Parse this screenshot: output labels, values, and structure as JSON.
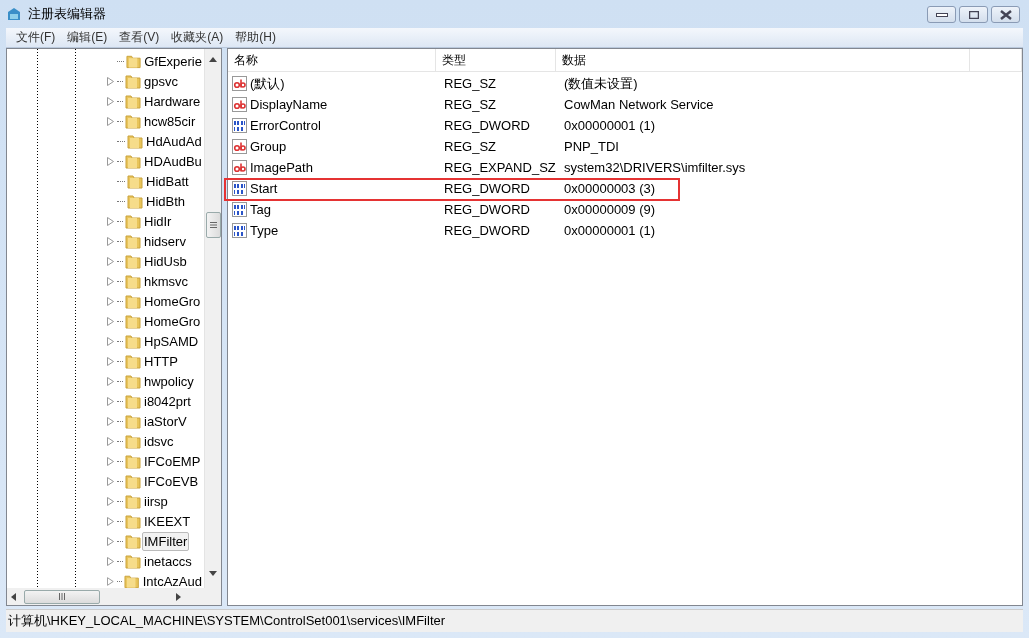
{
  "window": {
    "title": "注册表编辑器"
  },
  "menu": [
    "文件(F)",
    "编辑(E)",
    "查看(V)",
    "收藏夹(A)",
    "帮助(H)"
  ],
  "tree": [
    {
      "label": "GfExperie",
      "expandable": false,
      "selected": false
    },
    {
      "label": "gpsvc",
      "expandable": true,
      "selected": false
    },
    {
      "label": "Hardware",
      "expandable": true,
      "selected": false
    },
    {
      "label": "hcw85cir",
      "expandable": true,
      "selected": false
    },
    {
      "label": "HdAudAd",
      "expandable": false,
      "selected": false
    },
    {
      "label": "HDAudBu",
      "expandable": true,
      "selected": false
    },
    {
      "label": "HidBatt",
      "expandable": false,
      "selected": false
    },
    {
      "label": "HidBth",
      "expandable": false,
      "selected": false
    },
    {
      "label": "HidIr",
      "expandable": true,
      "selected": false
    },
    {
      "label": "hidserv",
      "expandable": true,
      "selected": false
    },
    {
      "label": "HidUsb",
      "expandable": true,
      "selected": false
    },
    {
      "label": "hkmsvc",
      "expandable": true,
      "selected": false
    },
    {
      "label": "HomeGro",
      "expandable": true,
      "selected": false
    },
    {
      "label": "HomeGro",
      "expandable": true,
      "selected": false
    },
    {
      "label": "HpSAMD",
      "expandable": true,
      "selected": false
    },
    {
      "label": "HTTP",
      "expandable": true,
      "selected": false
    },
    {
      "label": "hwpolicy",
      "expandable": true,
      "selected": false
    },
    {
      "label": "i8042prt",
      "expandable": true,
      "selected": false
    },
    {
      "label": "iaStorV",
      "expandable": true,
      "selected": false
    },
    {
      "label": "idsvc",
      "expandable": true,
      "selected": false
    },
    {
      "label": "IFCoEMP",
      "expandable": true,
      "selected": false
    },
    {
      "label": "IFCoEVB",
      "expandable": true,
      "selected": false
    },
    {
      "label": "iirsp",
      "expandable": true,
      "selected": false
    },
    {
      "label": "IKEEXT",
      "expandable": true,
      "selected": false
    },
    {
      "label": "IMFilter",
      "expandable": true,
      "selected": true
    },
    {
      "label": "inetaccs",
      "expandable": true,
      "selected": false
    },
    {
      "label": "IntcAzAud",
      "expandable": true,
      "selected": false
    }
  ],
  "table": {
    "columns": [
      "名称",
      "类型",
      "数据"
    ],
    "rows": [
      {
        "kind": "string",
        "name": "(默认)",
        "type": "REG_SZ",
        "data": "(数值未设置)",
        "highlighted": false
      },
      {
        "kind": "string",
        "name": "DisplayName",
        "type": "REG_SZ",
        "data": "CowMan Network Service",
        "highlighted": false
      },
      {
        "kind": "dword",
        "name": "ErrorControl",
        "type": "REG_DWORD",
        "data": "0x00000001 (1)",
        "highlighted": false
      },
      {
        "kind": "string",
        "name": "Group",
        "type": "REG_SZ",
        "data": "PNP_TDI",
        "highlighted": false
      },
      {
        "kind": "string",
        "name": "ImagePath",
        "type": "REG_EXPAND_SZ",
        "data": "system32\\DRIVERS\\imfilter.sys",
        "highlighted": false
      },
      {
        "kind": "dword",
        "name": "Start",
        "type": "REG_DWORD",
        "data": "0x00000003 (3)",
        "highlighted": true
      },
      {
        "kind": "dword",
        "name": "Tag",
        "type": "REG_DWORD",
        "data": "0x00000009 (9)",
        "highlighted": false
      },
      {
        "kind": "dword",
        "name": "Type",
        "type": "REG_DWORD",
        "data": "0x00000001 (1)",
        "highlighted": false
      }
    ]
  },
  "status_bar": "计算机\\HKEY_LOCAL_MACHINE\\SYSTEM\\ControlSet001\\services\\IMFilter"
}
